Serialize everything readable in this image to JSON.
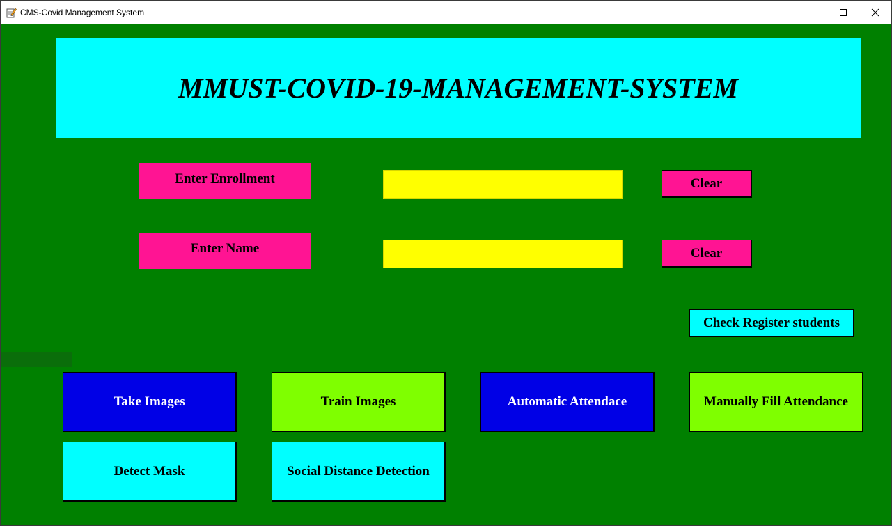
{
  "window": {
    "title": "CMS-Covid Management System",
    "icon": "notepad-pencil-icon"
  },
  "banner": {
    "title": "MMUST-COVID-19-MANAGEMENT-SYSTEM"
  },
  "form": {
    "enrollment_label": "Enter Enrollment",
    "enrollment_value": "",
    "name_label": "Enter Name",
    "name_value": "",
    "clear_label": "Clear"
  },
  "buttons": {
    "check_register": "Check Register students",
    "take_images": "Take Images",
    "train_images": "Train Images",
    "automatic_attendance": "Automatic Attendace",
    "manual_attendance": "Manually Fill Attendance",
    "detect_mask": "Detect Mask",
    "social_distance": "Social Distance Detection"
  },
  "colors": {
    "background": "#008000",
    "banner": "#00ffff",
    "label": "#ff1493",
    "entry": "#ffff00",
    "blue_button": "#0000e6",
    "lime_button": "#7fff00",
    "cyan_button": "#00ffff"
  }
}
